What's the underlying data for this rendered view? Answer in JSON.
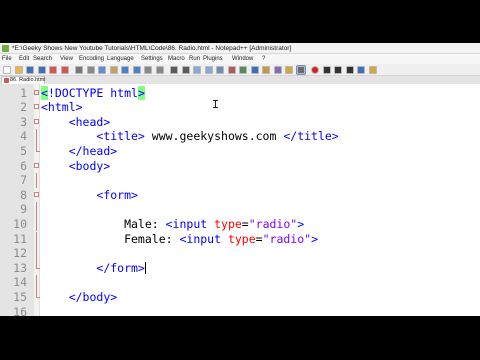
{
  "window": {
    "title": "*E:\\Geeky Shows New Youtube Tutorials\\HTML\\Code\\86. Radio.html - Notepad++ [Administrator]"
  },
  "menu": [
    "File",
    "Edit",
    "Search",
    "View",
    "Encoding",
    "Language",
    "Settings",
    "Macro",
    "Run",
    "Plugins",
    "Window",
    "?"
  ],
  "tab": {
    "label": "86. Radio.html"
  },
  "editor": {
    "lines": [
      {
        "n": "1",
        "parts": [
          {
            "t": "<",
            "c": "tag hl"
          },
          {
            "t": "!DOCTYPE html",
            "c": "tag"
          },
          {
            "t": ">",
            "c": "tag hl"
          }
        ]
      },
      {
        "n": "2",
        "parts": [
          {
            "t": "<html>",
            "c": "tag"
          }
        ]
      },
      {
        "n": "3",
        "parts": [
          {
            "t": "    ",
            "c": "txt"
          },
          {
            "t": "<head>",
            "c": "tag"
          }
        ]
      },
      {
        "n": "4",
        "parts": [
          {
            "t": "        ",
            "c": "txt"
          },
          {
            "t": "<title>",
            "c": "tag"
          },
          {
            "t": " www.geekyshows.com ",
            "c": "txt"
          },
          {
            "t": "</title>",
            "c": "tag"
          }
        ]
      },
      {
        "n": "5",
        "parts": [
          {
            "t": "    ",
            "c": "txt"
          },
          {
            "t": "</head>",
            "c": "tag"
          }
        ]
      },
      {
        "n": "6",
        "parts": [
          {
            "t": "    ",
            "c": "txt"
          },
          {
            "t": "<body>",
            "c": "tag"
          }
        ]
      },
      {
        "n": "7",
        "parts": []
      },
      {
        "n": "8",
        "parts": [
          {
            "t": "        ",
            "c": "txt"
          },
          {
            "t": "<form>",
            "c": "tag"
          }
        ]
      },
      {
        "n": "9",
        "parts": []
      },
      {
        "n": "10",
        "parts": [
          {
            "t": "            Male: ",
            "c": "txt"
          },
          {
            "t": "<input ",
            "c": "tag"
          },
          {
            "t": "type",
            "c": "attr"
          },
          {
            "t": "=",
            "c": "txt"
          },
          {
            "t": "\"radio\"",
            "c": "val"
          },
          {
            "t": ">",
            "c": "tag"
          }
        ]
      },
      {
        "n": "11",
        "parts": [
          {
            "t": "            Female: ",
            "c": "txt"
          },
          {
            "t": "<input ",
            "c": "tag"
          },
          {
            "t": "type",
            "c": "attr"
          },
          {
            "t": "=",
            "c": "txt"
          },
          {
            "t": "\"radio\"",
            "c": "val"
          },
          {
            "t": ">",
            "c": "tag"
          }
        ]
      },
      {
        "n": "12",
        "parts": []
      },
      {
        "n": "13",
        "parts": [
          {
            "t": "        ",
            "c": "txt"
          },
          {
            "t": "</form>",
            "c": "tag"
          }
        ],
        "caret": true
      },
      {
        "n": "14",
        "parts": []
      },
      {
        "n": "15",
        "parts": [
          {
            "t": "    ",
            "c": "txt"
          },
          {
            "t": "</body>",
            "c": "tag"
          }
        ]
      },
      {
        "n": "16",
        "parts": []
      }
    ],
    "folds": {
      "0": "box",
      "1": "box",
      "2": "box",
      "3": "vl",
      "4": "end",
      "5": "box",
      "6": "vl",
      "7": "box",
      "8": "vl",
      "9": "vl",
      "10": "vl",
      "11": "vl",
      "12": "end",
      "13": "vl",
      "14": "end"
    }
  },
  "toolbar": {
    "buttons": [
      {
        "name": "new-file-icon",
        "color": "#ffffff"
      },
      {
        "name": "open-file-icon",
        "color": "#e8b84a"
      },
      {
        "name": "save-icon",
        "color": "#3b6fb6"
      },
      {
        "name": "save-all-icon",
        "color": "#3b6fb6"
      },
      {
        "name": "close-icon",
        "color": "#d9534f"
      },
      {
        "name": "close-all-icon",
        "color": "#d9534f"
      },
      {
        "name": "print-icon",
        "color": "#777777"
      },
      {
        "name": "cut-icon",
        "color": "#888888"
      },
      {
        "name": "copy-icon",
        "color": "#5b8fd6"
      },
      {
        "name": "paste-icon",
        "color": "#c9a25a"
      },
      {
        "name": "undo-icon",
        "color": "#4a7fc9"
      },
      {
        "name": "redo-icon",
        "color": "#4a7fc9"
      },
      {
        "name": "find-icon",
        "color": "#888888"
      },
      {
        "name": "replace-icon",
        "color": "#888888"
      },
      {
        "name": "zoom-in-icon",
        "color": "#5a5a5a"
      },
      {
        "name": "zoom-out-icon",
        "color": "#5a5a5a"
      },
      {
        "name": "sync-v-icon",
        "color": "#8aa8d6"
      },
      {
        "name": "sync-h-icon",
        "color": "#8aa8d6"
      },
      {
        "name": "word-wrap-icon",
        "color": "#6f8fb0"
      },
      {
        "name": "all-chars-icon",
        "color": "#b05a5a"
      },
      {
        "name": "indent-guide-icon",
        "color": "#5a8a5a"
      },
      {
        "name": "lang-icon",
        "color": "#3a6fc0"
      },
      {
        "name": "doc-map-icon",
        "color": "#c89a3a"
      },
      {
        "name": "func-list-icon",
        "color": "#8a6ab0"
      },
      {
        "name": "folder-workspace-icon",
        "color": "#d0a840"
      },
      {
        "name": "monitor-icon",
        "color": "#6a6a6a"
      },
      {
        "name": "record-macro-icon",
        "color": "#d02020"
      },
      {
        "name": "stop-macro-icon",
        "color": "#333333"
      },
      {
        "name": "play-macro-icon",
        "color": "#333333"
      },
      {
        "name": "run-macro-multiple-icon",
        "color": "#333333"
      },
      {
        "name": "save-macro-icon",
        "color": "#3b6fb6"
      },
      {
        "name": "spell-check-icon",
        "color": "#d0a840"
      }
    ]
  }
}
